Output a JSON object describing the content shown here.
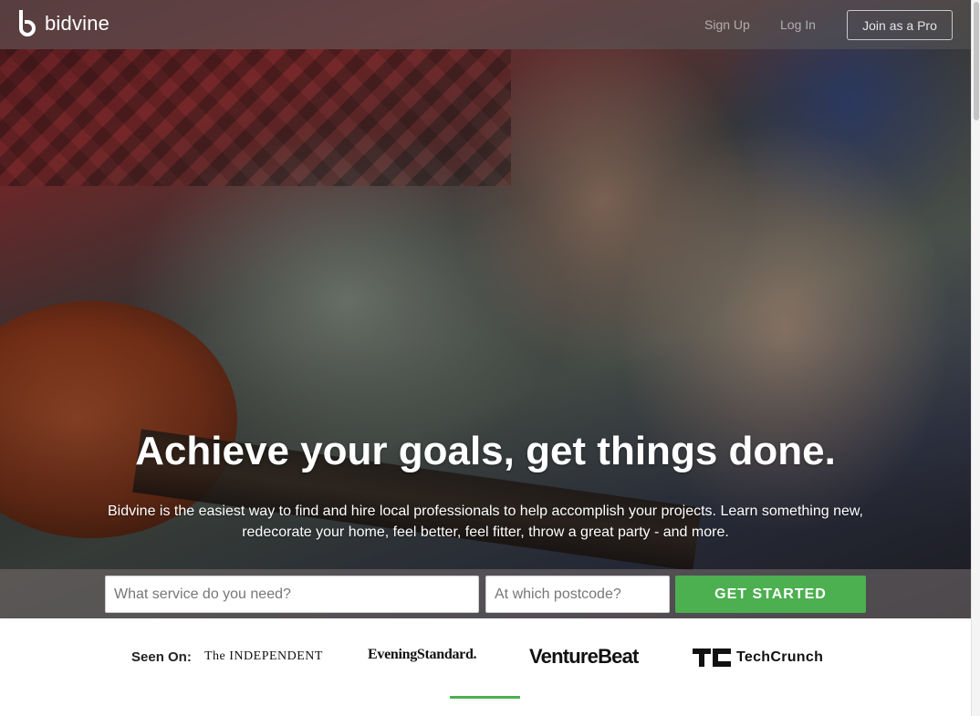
{
  "brand": {
    "name": "bidvine",
    "logo_icon": "bidvine-b-logo-icon"
  },
  "nav": {
    "signup": "Sign Up",
    "login": "Log In",
    "join_pro": "Join as a Pro"
  },
  "hero": {
    "headline": "Achieve your goals, get things done.",
    "subline": "Bidvine is the easiest way to find and hire local professionals to help accomplish your projects. Learn something new, redecorate your home, feel better, feel fitter, throw a great party - and more."
  },
  "search": {
    "service_placeholder": "What service do you need?",
    "postcode_placeholder": "At which postcode?",
    "cta_label": "GET STARTED",
    "cta_color": "#4caf50"
  },
  "seen_on": {
    "label": "Seen On:",
    "outlets": {
      "independent": "The INDEPENDENT",
      "standard": "EveningStandard.",
      "venturebeat": "VentureBeat",
      "techcrunch": "TechCrunch"
    },
    "accent_color": "#4caf50"
  }
}
